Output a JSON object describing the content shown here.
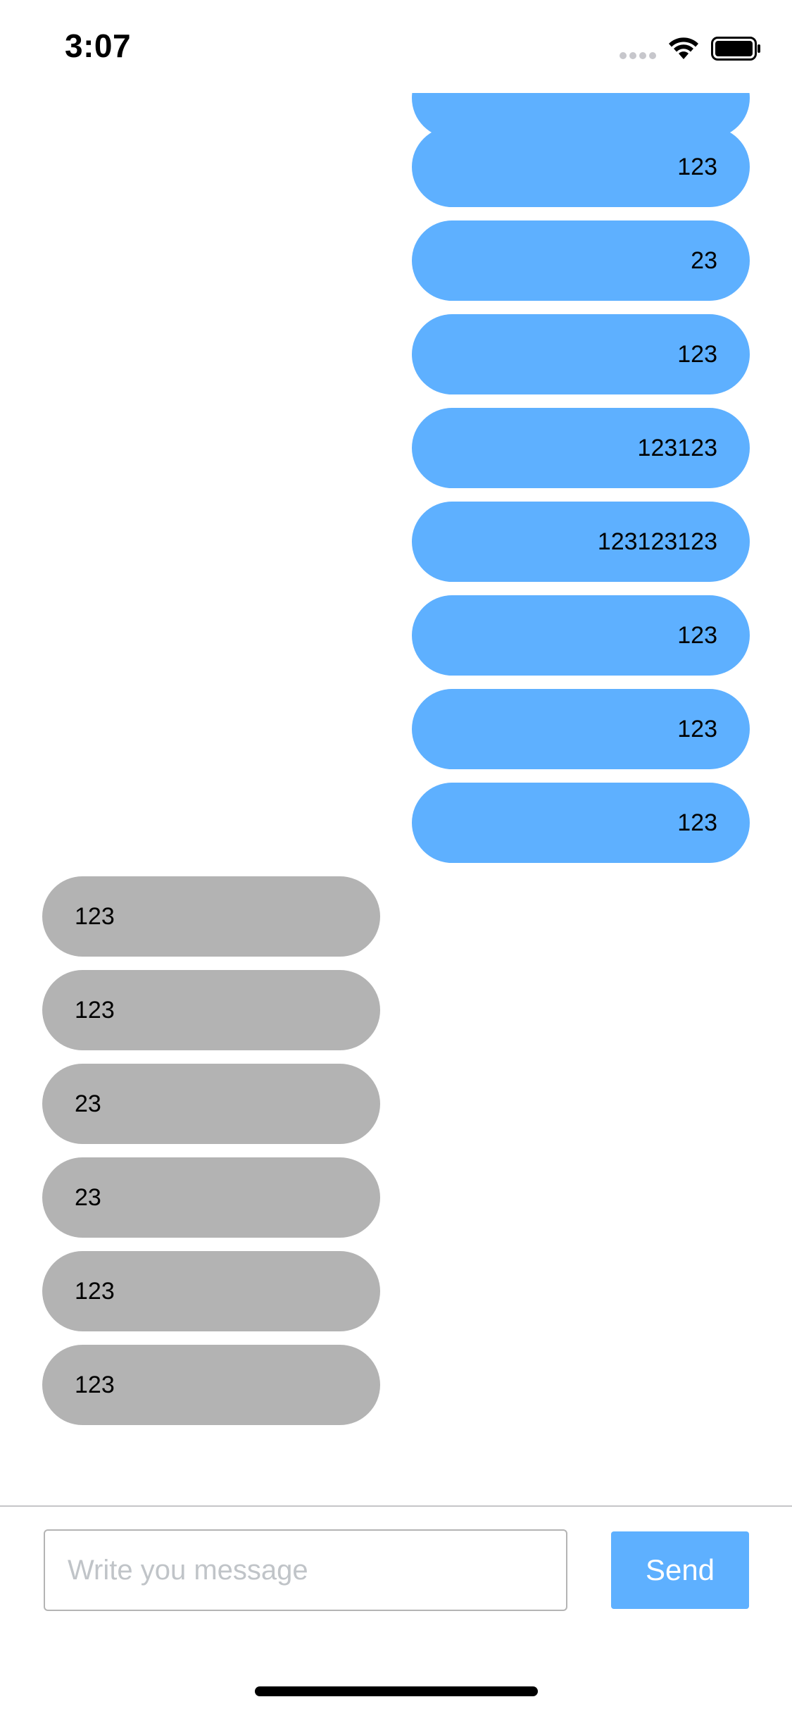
{
  "status_bar": {
    "time": "3:07"
  },
  "messages": {
    "sent": [
      {
        "text": ""
      },
      {
        "text": "123"
      },
      {
        "text": "23"
      },
      {
        "text": "123"
      },
      {
        "text": "123123"
      },
      {
        "text": "123123123"
      },
      {
        "text": "123"
      },
      {
        "text": "123"
      },
      {
        "text": "123"
      }
    ],
    "received": [
      {
        "text": "123"
      },
      {
        "text": "123"
      },
      {
        "text": "23"
      },
      {
        "text": "23"
      },
      {
        "text": "123"
      },
      {
        "text": "123"
      }
    ]
  },
  "composer": {
    "placeholder": "Write you message",
    "value": "",
    "send_label": "Send"
  },
  "colors": {
    "sent_bubble": "#5eb0ff",
    "received_bubble": "#b3b3b3",
    "send_button": "#5eb0ff"
  }
}
